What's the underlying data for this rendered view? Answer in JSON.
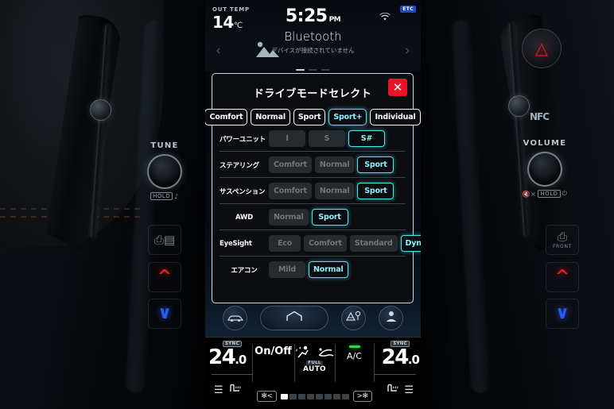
{
  "status": {
    "out_temp_label": "OUT TEMP",
    "out_temp_value": "14",
    "out_temp_unit": "℃",
    "clock": "5:25",
    "ampm": "PM",
    "etc_badge": "ETC",
    "wifi_icon": "wifi-icon"
  },
  "media": {
    "title": "Bluetooth",
    "subtitle": "デバイスが接続されていません",
    "prev_icon": "chevron-left-icon",
    "next_icon": "chevron-right-icon",
    "album_art_icon": "image-placeholder-icon",
    "page_dots": 3,
    "active_dot": 0
  },
  "dialog": {
    "title": "ドライブモードセレクト",
    "close_icon": "close-icon",
    "close_label": "✕",
    "modes": [
      {
        "label": "Comfort",
        "selected": false
      },
      {
        "label": "Normal",
        "selected": false
      },
      {
        "label": "Sport",
        "selected": false
      },
      {
        "label": "Sport+",
        "selected": true
      },
      {
        "label": "Individual",
        "selected": false
      }
    ],
    "rows": [
      {
        "label": "パワーユニット",
        "center": false,
        "options": [
          {
            "label": "I",
            "selected": false
          },
          {
            "label": "S",
            "selected": false
          },
          {
            "label": "S#",
            "selected": true
          }
        ]
      },
      {
        "label": "ステアリング",
        "center": false,
        "options": [
          {
            "label": "Comfort",
            "selected": false
          },
          {
            "label": "Normal",
            "selected": false
          },
          {
            "label": "Sport",
            "selected": true
          }
        ]
      },
      {
        "label": "サスペンション",
        "center": false,
        "options": [
          {
            "label": "Comfort",
            "selected": false
          },
          {
            "label": "Normal",
            "selected": false
          },
          {
            "label": "Sport",
            "selected": true
          }
        ]
      },
      {
        "label": "AWD",
        "center": true,
        "options": [
          {
            "label": "Normal",
            "selected": false
          },
          {
            "label": "Sport",
            "selected": true
          }
        ]
      },
      {
        "label": "EyeSight",
        "center": false,
        "options": [
          {
            "label": "Eco",
            "selected": false
          },
          {
            "label": "Comfort",
            "selected": false
          },
          {
            "label": "Standard",
            "selected": false
          },
          {
            "label": "Dynamic",
            "selected": true
          }
        ]
      },
      {
        "label": "エアコン",
        "center": true,
        "options": [
          {
            "label": "Mild",
            "selected": false
          },
          {
            "label": "Normal",
            "selected": true
          }
        ]
      }
    ]
  },
  "navbar": {
    "items": [
      {
        "name": "car-icon",
        "label": "car"
      },
      {
        "name": "home-icon",
        "label": "home"
      },
      {
        "name": "navigation-map-icon",
        "label": "map"
      },
      {
        "name": "seat-person-icon",
        "label": "profile"
      }
    ]
  },
  "climate": {
    "left": {
      "sync_badge": "SYNC",
      "temp_whole": "24",
      "temp_decimal": ".0",
      "seat_icon": "seat-heater-icon",
      "menu_icon": "menu-lines-icon"
    },
    "right": {
      "sync_badge": "SYNC",
      "temp_whole": "24",
      "temp_decimal": ".0",
      "seat_icon": "seat-heater-icon",
      "menu_icon": "menu-lines-icon"
    },
    "onoff_label": "On/Off",
    "full_badge": "FULL",
    "auto_label": "AUTO",
    "ac_label": "A/C",
    "defrost_front_icon": "front-defroster-icon",
    "defrost_rear_icon": "rear-defroster-icon",
    "fan_left_label": "✻<",
    "fan_right_label": ">✻",
    "fan_bars_total": 8,
    "fan_bars_on": 1
  },
  "dashboard": {
    "tune": {
      "label": "TUNE",
      "hold": "HOLD",
      "note": "♪"
    },
    "volume": {
      "label": "VOLUME",
      "hold": "HOLD",
      "mute": "🔇×",
      "power": "⏻"
    },
    "hazard_icon": "hazard-triangle-icon",
    "nfc_label": "NFC",
    "front_defrost_label": "FRONT",
    "temp_up_icon": "chevron-up-icon",
    "temp_down_icon": "chevron-down-icon",
    "rear_defrost_icon": "rear-defroster-icon"
  },
  "colors": {
    "accent_cyan": "#46e8f5",
    "close_red": "#e8152a",
    "hazard_red": "#d81f1f",
    "ac_green": "#2ad94a",
    "etc_blue": "#1d49c9",
    "arrow_up_red": "#e02020",
    "arrow_down_blue": "#2a5cf0"
  }
}
